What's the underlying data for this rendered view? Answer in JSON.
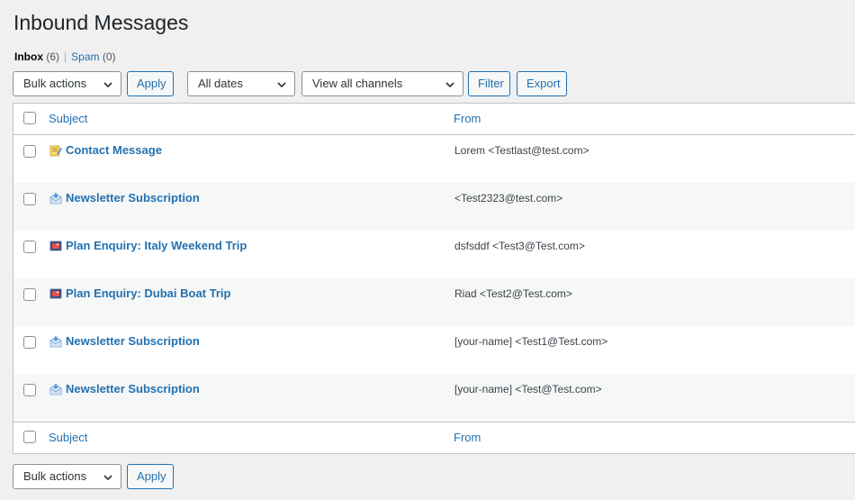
{
  "page": {
    "title": "Inbound Messages"
  },
  "views": {
    "inbox_label": "Inbox",
    "inbox_count": "(6)",
    "separator": "|",
    "spam_label": "Spam",
    "spam_count": "(0)"
  },
  "toolbar": {
    "bulk_actions": "Bulk actions",
    "apply": "Apply",
    "dates": "All dates",
    "channels": "View all channels",
    "filter": "Filter",
    "export": "Export"
  },
  "table": {
    "header_subject": "Subject",
    "header_from": "From",
    "rows": [
      {
        "icon": "note-icon",
        "subject": "Contact Message",
        "from": "Lorem <Testlast@test.com>"
      },
      {
        "icon": "newsletter-icon",
        "subject": "Newsletter Subscription",
        "from": "<Test2323@test.com>"
      },
      {
        "icon": "plan-icon",
        "subject": "Plan Enquiry: Italy Weekend Trip",
        "from": "dsfsddf <Test3@Test.com>"
      },
      {
        "icon": "plan-icon",
        "subject": "Plan Enquiry: Dubai Boat Trip",
        "from": "Riad <Test2@Test.com>"
      },
      {
        "icon": "newsletter-icon",
        "subject": "Newsletter Subscription",
        "from": "[your-name] <Test1@Test.com>"
      },
      {
        "icon": "newsletter-icon",
        "subject": "Newsletter Subscription",
        "from": "[your-name] <Test@Test.com>"
      }
    ]
  },
  "bottom_toolbar": {
    "bulk_actions": "Bulk actions",
    "apply": "Apply"
  },
  "colors": {
    "link": "#2271b1",
    "background": "#f0f0f1",
    "alt_row": "#f6f7f7"
  }
}
